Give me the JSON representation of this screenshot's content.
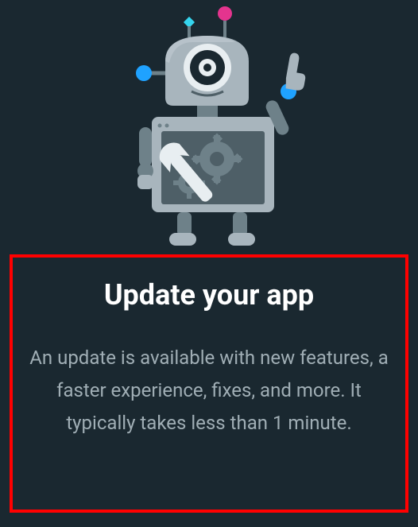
{
  "update_prompt": {
    "title": "Update your app",
    "description": "An update is available with new features, a faster experience, fixes, and more. It typically takes less than 1 minute."
  },
  "illustration": {
    "name": "maintenance-robot",
    "colors": {
      "body_light": "#a8b5bd",
      "body_dark": "#6e8189",
      "body_darker": "#4e5f67",
      "accent_blue": "#1fa2ff",
      "accent_cyan": "#35d5ee",
      "accent_pink": "#e4348e",
      "wrench": "#e8eef1"
    }
  }
}
